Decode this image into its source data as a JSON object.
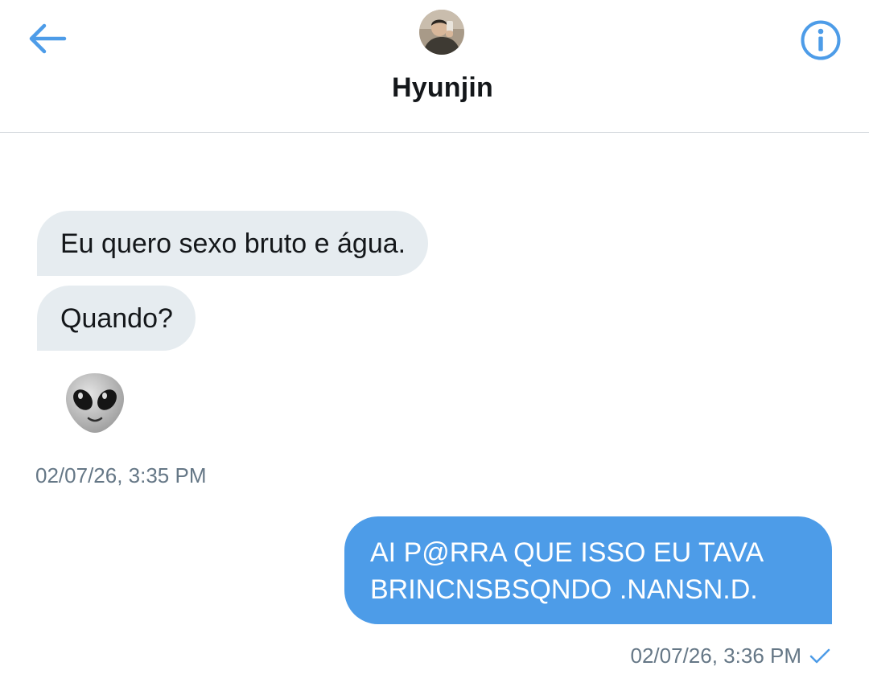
{
  "header": {
    "contact_name": "Hyunjin",
    "back_icon": "arrow-left-icon",
    "info_icon": "info-circle-icon",
    "accent_color": "#4d9ce8"
  },
  "messages": [
    {
      "direction": "incoming",
      "text": "Eu quero sexo bruto e água."
    },
    {
      "direction": "incoming",
      "text": "Quando?"
    },
    {
      "direction": "incoming",
      "type": "emoji",
      "emoji": "alien-emoji"
    }
  ],
  "incoming_timestamp": "02/07/26, 3:35 PM",
  "outgoing": {
    "line1": "AI P@RRA QUE ISSO EU TAVA",
    "line2": "BRINCNSBSQNDO .NANSN.D.",
    "timestamp": "02/07/26, 3:36 PM",
    "status_icon": "checkmark-icon"
  }
}
